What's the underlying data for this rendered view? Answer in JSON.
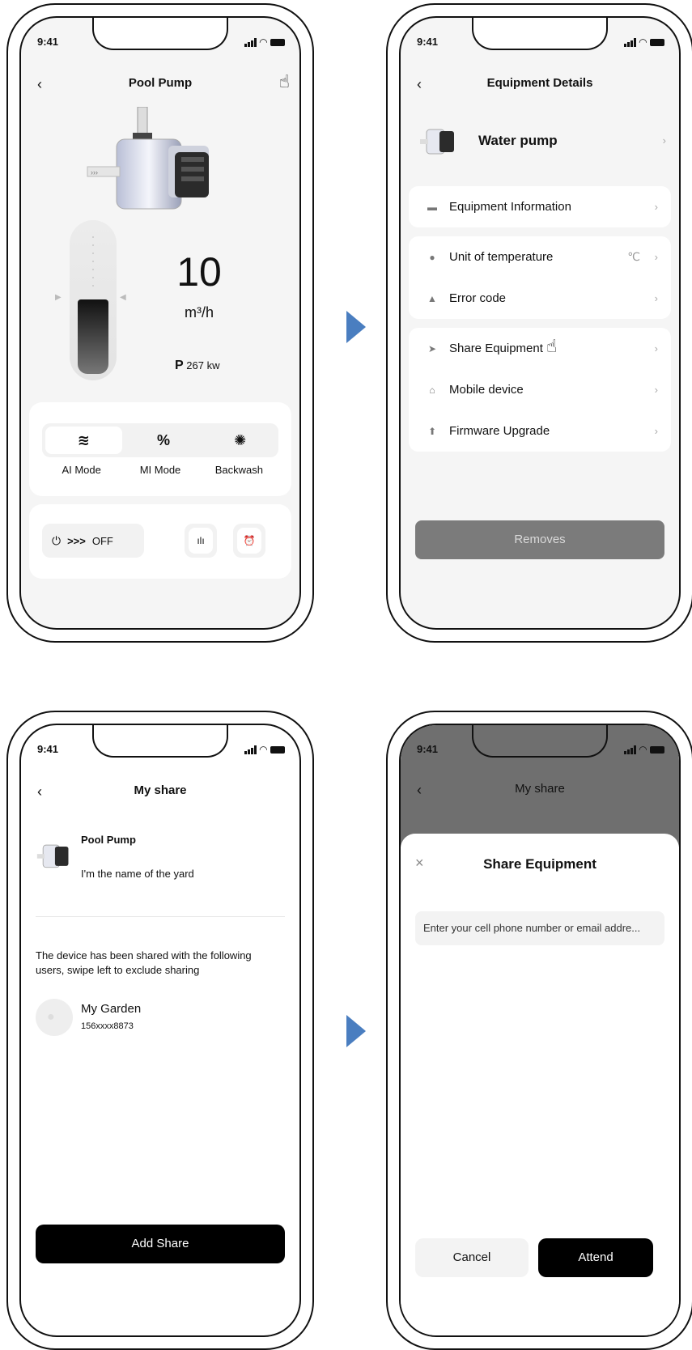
{
  "status_time": "9:41",
  "screen1": {
    "title": "Pool Pump",
    "flow_value": "10",
    "flow_unit": "m³/h",
    "power_prefix": "P",
    "power_value": "267 kw",
    "modes": [
      {
        "icon": "≋",
        "label": "AI Mode"
      },
      {
        "icon": "%",
        "label": "MI Mode"
      },
      {
        "icon": "✺",
        "label": "Backwash"
      }
    ],
    "arrows": ">>>",
    "off_label": "OFF"
  },
  "screen2": {
    "title": "Equipment Details",
    "device_name": "Water pump",
    "rows": [
      {
        "label": "Equipment Information"
      },
      {
        "label": "Unit of temperature",
        "extra": "℃"
      },
      {
        "label": "Error code"
      },
      {
        "label": "Share Equipment"
      },
      {
        "label": "Mobile device"
      },
      {
        "label": "Firmware Upgrade"
      }
    ],
    "remove_label": "Removes"
  },
  "screen3": {
    "title": "My share",
    "device_name": "Pool Pump",
    "yard_name": "I'm the name of the yard",
    "info_text": "The device has been shared with the following users, swipe left to exclude sharing",
    "user_name": "My Garden",
    "user_phone": "156xxxx8873",
    "add_label": "Add Share"
  },
  "screen4": {
    "title": "My share",
    "sheet_title": "Share Equipment",
    "close_glyph": "×",
    "input_placeholder": "Enter your cell phone number or email addre...",
    "cancel_label": "Cancel",
    "attend_label": "Attend"
  },
  "colors": {
    "accent_arrow": "#4a7ec0",
    "primary_button": "#000000",
    "disabled_button": "#7b7b7b"
  }
}
